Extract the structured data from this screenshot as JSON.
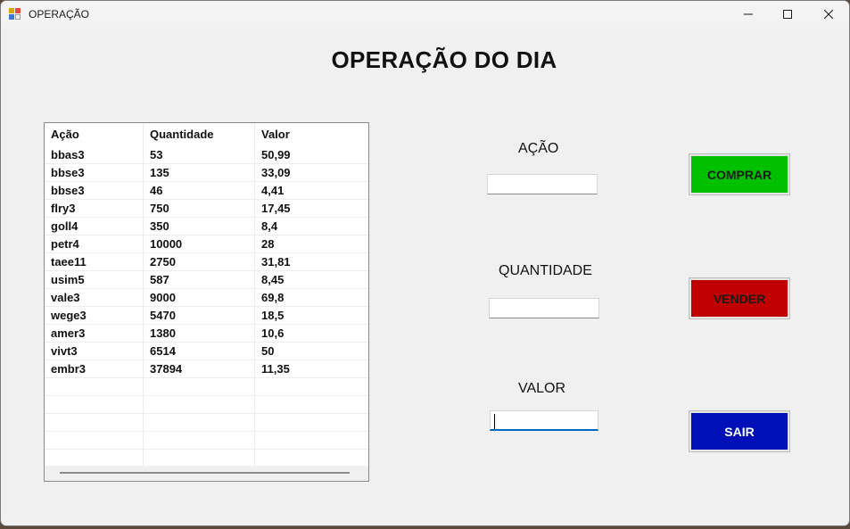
{
  "window": {
    "title": "OPERAÇÃO",
    "controls": {
      "minimize": "minimize-icon",
      "maximize": "maximize-icon",
      "close": "close-icon"
    }
  },
  "heading": "OPERAÇÃO DO DIA",
  "grid": {
    "columns": [
      "Ação",
      "Quantidade",
      "Valor"
    ],
    "rows": [
      [
        "bbas3",
        "53",
        "50,99"
      ],
      [
        "bbse3",
        "135",
        "33,09"
      ],
      [
        "bbse3",
        "46",
        "4,41"
      ],
      [
        "flry3",
        "750",
        "17,45"
      ],
      [
        "goll4",
        "350",
        "8,4"
      ],
      [
        "petr4",
        "10000",
        "28"
      ],
      [
        "taee11",
        "2750",
        "31,81"
      ],
      [
        "usim5",
        "587",
        "8,45"
      ],
      [
        "vale3",
        "9000",
        "69,8"
      ],
      [
        "wege3",
        "5470",
        "18,5"
      ],
      [
        "amer3",
        "1380",
        "10,6"
      ],
      [
        "vivt3",
        "6514",
        "50"
      ],
      [
        "embr3",
        "37894",
        "11,35"
      ]
    ],
    "empty_rows": 5
  },
  "form": {
    "acao_label": "AÇÃO",
    "acao_value": "",
    "quantidade_label": "QUANTIDADE",
    "quantidade_value": "",
    "valor_label": "VALOR",
    "valor_value": ""
  },
  "buttons": {
    "comprar": {
      "label": "COMPRAR",
      "color": "#00c000",
      "text_color": "#1a1a1a"
    },
    "vender": {
      "label": "VENDER",
      "color": "#c00000",
      "text_color": "#1a1a1a"
    },
    "sair": {
      "label": "SAIR",
      "color": "#0010b8",
      "text_color": "#ffffff"
    }
  }
}
